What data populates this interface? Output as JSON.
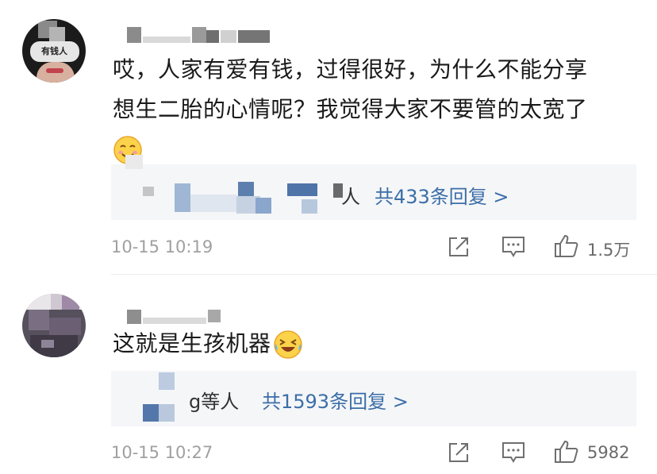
{
  "comments": [
    {
      "avatar_text": "有钱人",
      "text_line1": "哎，人家有爱有钱，过得很好，为什么不能分享",
      "text_line2": "想生二胎的心情呢？我觉得大家不要管的太宽了",
      "emoji": "smile-emoji",
      "reply_suffix": "人",
      "reply_count": "共433条回复 >",
      "time": "10-15 10:19",
      "likes": "1.5万"
    },
    {
      "text": "这就是生孩机器",
      "emoji": "laugh-cry-emoji",
      "reply_suffix": "g等人",
      "reply_count": "共1593条回复 >",
      "time": "10-15 10:27",
      "likes": "5982"
    }
  ],
  "colors": {
    "link": "#3b6ea8",
    "meta": "#a0a0a0",
    "reply_bg": "#f5f6f8"
  },
  "icons": [
    "share-icon",
    "comment-icon",
    "like-icon"
  ]
}
